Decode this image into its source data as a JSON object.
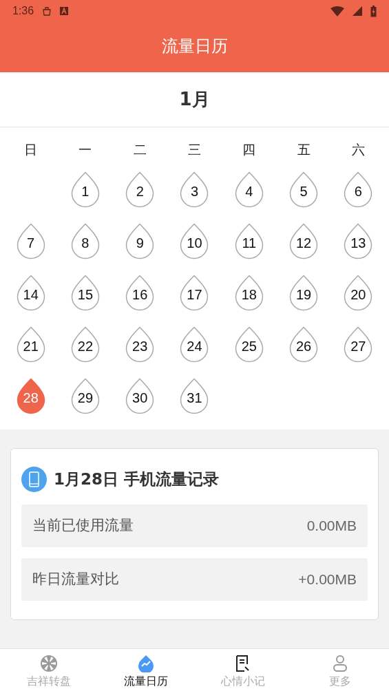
{
  "status_bar": {
    "time": "1:36"
  },
  "header": {
    "title": "流量日历"
  },
  "calendar": {
    "month": "1月",
    "weekdays": [
      "日",
      "一",
      "二",
      "三",
      "四",
      "五",
      "六"
    ],
    "days": [
      {
        "kind": "blank"
      },
      {
        "kind": "day",
        "label": "1",
        "selected": false
      },
      {
        "kind": "day",
        "label": "2",
        "selected": false
      },
      {
        "kind": "day",
        "label": "3",
        "selected": false
      },
      {
        "kind": "day",
        "label": "4",
        "selected": false
      },
      {
        "kind": "day",
        "label": "5",
        "selected": false
      },
      {
        "kind": "day",
        "label": "6",
        "selected": false
      },
      {
        "kind": "day",
        "label": "7",
        "selected": false
      },
      {
        "kind": "day",
        "label": "8",
        "selected": false
      },
      {
        "kind": "day",
        "label": "9",
        "selected": false
      },
      {
        "kind": "day",
        "label": "10",
        "selected": false
      },
      {
        "kind": "day",
        "label": "11",
        "selected": false
      },
      {
        "kind": "day",
        "label": "12",
        "selected": false
      },
      {
        "kind": "day",
        "label": "13",
        "selected": false
      },
      {
        "kind": "day",
        "label": "14",
        "selected": false
      },
      {
        "kind": "day",
        "label": "15",
        "selected": false
      },
      {
        "kind": "day",
        "label": "16",
        "selected": false
      },
      {
        "kind": "day",
        "label": "17",
        "selected": false
      },
      {
        "kind": "day",
        "label": "18",
        "selected": false
      },
      {
        "kind": "day",
        "label": "19",
        "selected": false
      },
      {
        "kind": "day",
        "label": "20",
        "selected": false
      },
      {
        "kind": "day",
        "label": "21",
        "selected": false
      },
      {
        "kind": "day",
        "label": "22",
        "selected": false
      },
      {
        "kind": "day",
        "label": "23",
        "selected": false
      },
      {
        "kind": "day",
        "label": "24",
        "selected": false
      },
      {
        "kind": "day",
        "label": "25",
        "selected": false
      },
      {
        "kind": "day",
        "label": "26",
        "selected": false
      },
      {
        "kind": "day",
        "label": "27",
        "selected": false
      },
      {
        "kind": "day",
        "label": "28",
        "selected": true
      },
      {
        "kind": "day",
        "label": "29",
        "selected": false
      },
      {
        "kind": "day",
        "label": "30",
        "selected": false
      },
      {
        "kind": "day",
        "label": "31",
        "selected": false
      }
    ]
  },
  "record": {
    "title": "1月28日 手机流量记录",
    "rows": [
      {
        "label": "当前已使用流量",
        "value": "0.00MB"
      },
      {
        "label": "昨日流量对比",
        "value": "+0.00MB"
      }
    ]
  },
  "nav": [
    {
      "kind": "wheel",
      "label": "吉祥转盘",
      "selected": false
    },
    {
      "kind": "chart",
      "label": "流量日历",
      "selected": true
    },
    {
      "kind": "note",
      "label": "心情小记",
      "selected": false
    },
    {
      "kind": "user",
      "label": "更多",
      "selected": false
    }
  ]
}
